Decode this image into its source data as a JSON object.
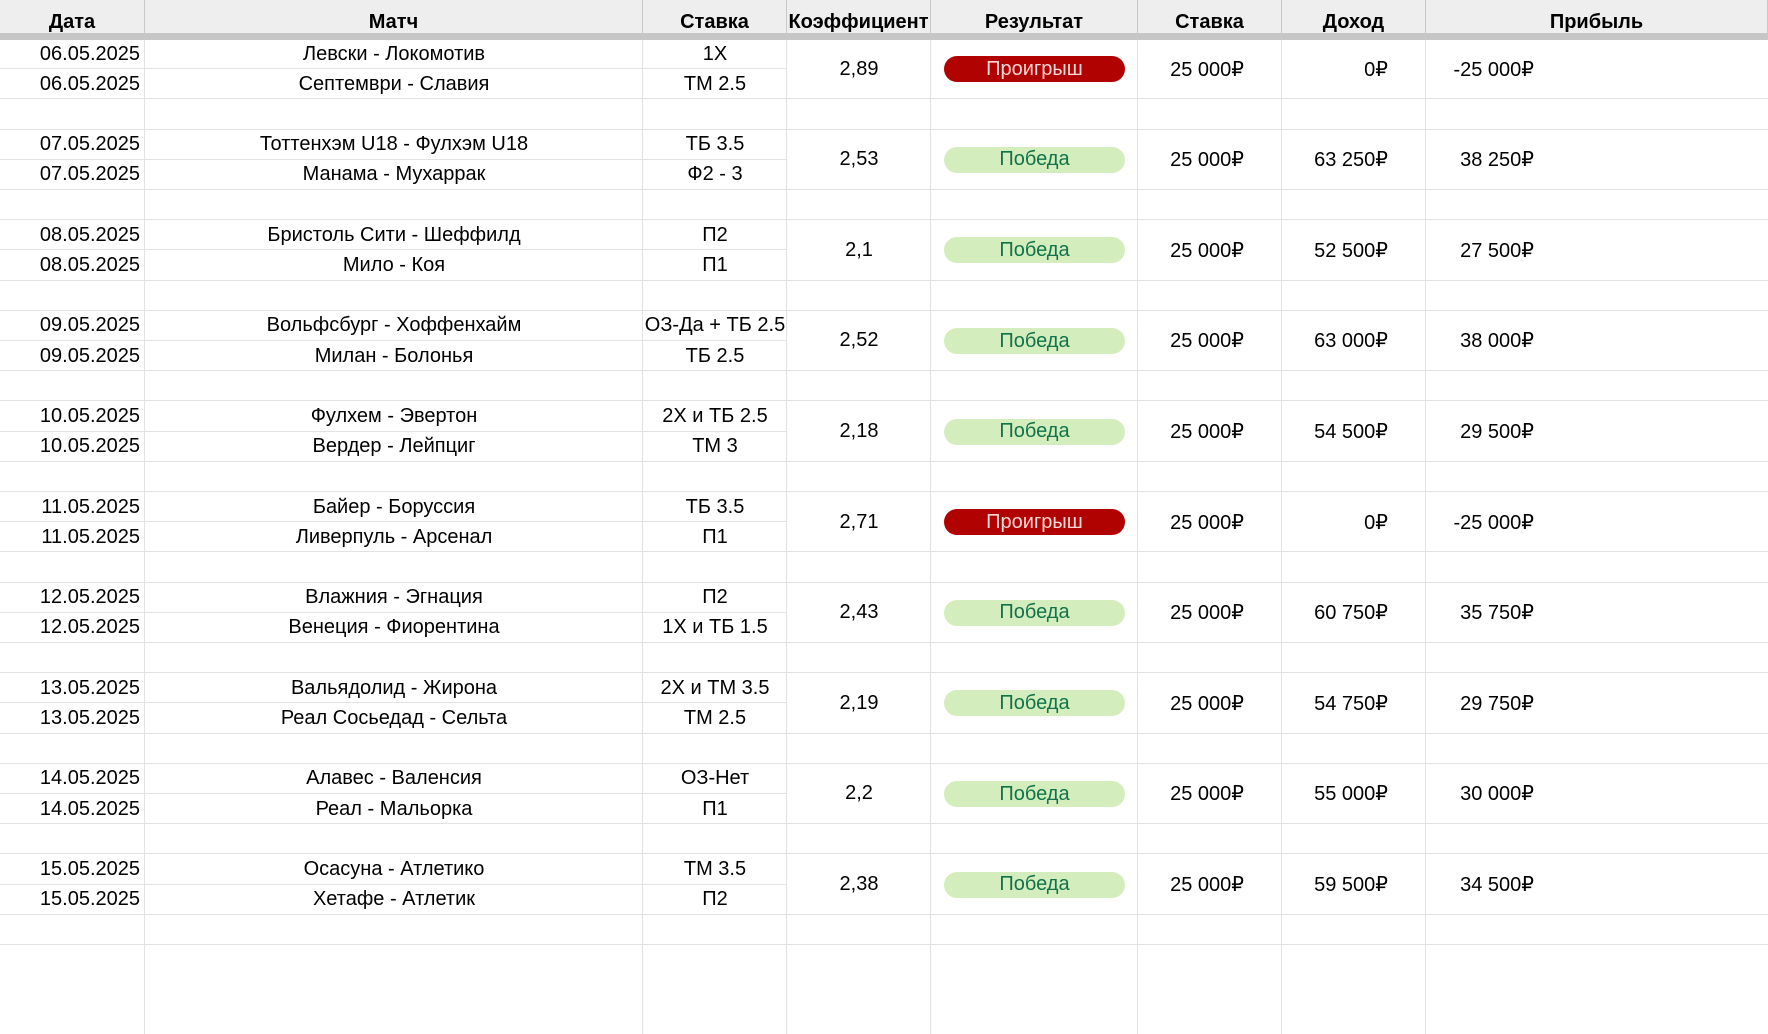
{
  "sheet": {
    "headers": [
      "Дата",
      "Матч",
      "Ставка",
      "Коэффициент",
      "Результат",
      "Ставка",
      "Доход",
      "Прибыль"
    ],
    "colors": {
      "win_bg": "#d4edbc",
      "win_text": "#11734b",
      "loss_bg": "#b10202",
      "loss_text": "#ffd6d6"
    },
    "groups": [
      {
        "date1": "06.05.2025",
        "match1": "Левски - Локомотив",
        "bet1": "1Х",
        "date2": "06.05.2025",
        "match2": "Септември - Славия",
        "bet2": "ТМ 2.5",
        "coef": "2,89",
        "result": "Проигрыш",
        "result_type": "loss",
        "stake": "25 000₽",
        "income": "0₽",
        "profit": "-25 000₽"
      },
      {
        "date1": "07.05.2025",
        "match1": "Тоттенхэм U18 - Фулхэм U18",
        "bet1": "ТБ 3.5",
        "date2": "07.05.2025",
        "match2": "Манама - Мухаррак",
        "bet2": "Ф2 - 3",
        "coef": "2,53",
        "result": "Победа",
        "result_type": "win",
        "stake": "25 000₽",
        "income": "63 250₽",
        "profit": "38 250₽"
      },
      {
        "date1": "08.05.2025",
        "match1": "Бристоль Сити - Шеффилд",
        "bet1": "П2",
        "date2": "08.05.2025",
        "match2": "Мило - Коя",
        "bet2": "П1",
        "coef": "2,1",
        "result": "Победа",
        "result_type": "win",
        "stake": "25 000₽",
        "income": "52 500₽",
        "profit": "27 500₽"
      },
      {
        "date1": "09.05.2025",
        "match1": "Вольфсбург - Хоффенхайм",
        "bet1": "ОЗ-Да + ТБ 2.5",
        "date2": "09.05.2025",
        "match2": "Милан - Болонья",
        "bet2": "ТБ 2.5",
        "coef": "2,52",
        "result": "Победа",
        "result_type": "win",
        "stake": "25 000₽",
        "income": "63 000₽",
        "profit": "38 000₽"
      },
      {
        "date1": "10.05.2025",
        "match1": "Фулхем - Эвертон",
        "bet1": "2Х и ТБ 2.5",
        "date2": "10.05.2025",
        "match2": "Вердер - Лейпциг",
        "bet2": "ТМ 3",
        "coef": "2,18",
        "result": "Победа",
        "result_type": "win",
        "stake": "25 000₽",
        "income": "54 500₽",
        "profit": "29 500₽"
      },
      {
        "date1": "11.05.2025",
        "match1": "Байер - Боруссия",
        "bet1": "ТБ 3.5",
        "date2": "11.05.2025",
        "match2": "Ливерпуль - Арсенал",
        "bet2": "П1",
        "coef": "2,71",
        "result": "Проигрыш",
        "result_type": "loss",
        "stake": "25 000₽",
        "income": "0₽",
        "profit": "-25 000₽"
      },
      {
        "date1": "12.05.2025",
        "match1": "Влажния - Эгнация",
        "bet1": "П2",
        "date2": "12.05.2025",
        "match2": "Венеция - Фиорентина",
        "bet2": "1Х и ТБ 1.5",
        "coef": "2,43",
        "result": "Победа",
        "result_type": "win",
        "stake": "25 000₽",
        "income": "60 750₽",
        "profit": "35 750₽"
      },
      {
        "date1": "13.05.2025",
        "match1": "Вальядолид - Жирона",
        "bet1": "2Х и ТМ 3.5",
        "date2": "13.05.2025",
        "match2": "Реал Сосьедад - Сельта",
        "bet2": "ТМ 2.5",
        "coef": "2,19",
        "result": "Победа",
        "result_type": "win",
        "stake": "25 000₽",
        "income": "54 750₽",
        "profit": "29 750₽"
      },
      {
        "date1": "14.05.2025",
        "match1": "Алавес - Валенсия",
        "bet1": "ОЗ-Нет",
        "date2": "14.05.2025",
        "match2": "Реал - Мальорка",
        "bet2": "П1",
        "coef": "2,2",
        "result": "Победа",
        "result_type": "win",
        "stake": "25 000₽",
        "income": "55 000₽",
        "profit": "30 000₽"
      },
      {
        "date1": "15.05.2025",
        "match1": "Осасуна - Атлетико",
        "bet1": "ТМ 3.5",
        "date2": "15.05.2025",
        "match2": "Хетафе - Атлетик",
        "bet2": "П2",
        "coef": "2,38",
        "result": "Победа",
        "result_type": "win",
        "stake": "25 000₽",
        "income": "59 500₽",
        "profit": "34 500₽"
      }
    ]
  }
}
